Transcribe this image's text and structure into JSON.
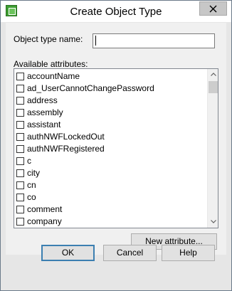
{
  "window": {
    "title": "Create Object Type",
    "app_icon": "window-app-icon",
    "close_icon": "close-icon"
  },
  "form": {
    "object_type_label": "Object type name:",
    "object_type_value": "",
    "attributes_label": "Available attributes:"
  },
  "attributes": {
    "items": [
      {
        "label": "accountName",
        "checked": false
      },
      {
        "label": "ad_UserCannotChangePassword",
        "checked": false
      },
      {
        "label": "address",
        "checked": false
      },
      {
        "label": "assembly",
        "checked": false
      },
      {
        "label": "assistant",
        "checked": false
      },
      {
        "label": "authNWFLockedOut",
        "checked": false
      },
      {
        "label": "authNWFRegistered",
        "checked": false
      },
      {
        "label": "c",
        "checked": false
      },
      {
        "label": "city",
        "checked": false
      },
      {
        "label": "cn",
        "checked": false
      },
      {
        "label": "co",
        "checked": false
      },
      {
        "label": "comment",
        "checked": false
      },
      {
        "label": "company",
        "checked": false
      }
    ],
    "scroll_up_icon": "scroll-up-arrow-icon",
    "scroll_down_icon": "scroll-down-arrow-icon"
  },
  "buttons": {
    "new_attribute": "New attribute...",
    "ok": "OK",
    "cancel": "Cancel",
    "help": "Help"
  }
}
